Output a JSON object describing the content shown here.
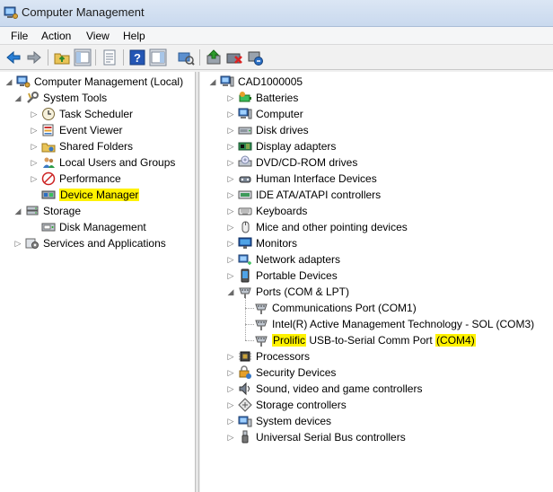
{
  "window": {
    "title": "Computer Management",
    "icon": "computer-management-icon"
  },
  "menu": [
    "File",
    "Action",
    "View",
    "Help"
  ],
  "toolbar": [
    "back-arrow-icon",
    "forward-arrow-icon",
    "up-folder-icon",
    "show-hide-console-tree-icon",
    "properties-icon",
    "help-icon",
    "action-pane-icon",
    "device-scan-icon",
    "update-driver-icon",
    "disable-device-icon",
    "uninstall-device-icon"
  ],
  "left_tree": [
    {
      "label": "Computer Management (Local)",
      "icon": "computer-management-icon",
      "expander": "expanded"
    },
    {
      "label": "System Tools",
      "icon": "system-tools-icon",
      "expander": "expanded"
    },
    {
      "label": "Task Scheduler",
      "icon": "task-scheduler-icon",
      "expander": "collapsed"
    },
    {
      "label": "Event Viewer",
      "icon": "event-viewer-icon",
      "expander": "collapsed"
    },
    {
      "label": "Shared Folders",
      "icon": "shared-folders-icon",
      "expander": "collapsed"
    },
    {
      "label": "Local Users and Groups",
      "icon": "users-icon",
      "expander": "collapsed"
    },
    {
      "label": "Performance",
      "icon": "performance-icon",
      "expander": "collapsed"
    },
    {
      "label": "Device Manager",
      "icon": "device-manager-icon",
      "expander": "none",
      "highlight": true
    },
    {
      "label": "Storage",
      "icon": "storage-icon",
      "expander": "expanded"
    },
    {
      "label": "Disk Management",
      "icon": "disk-management-icon",
      "expander": "none"
    },
    {
      "label": "Services and Applications",
      "icon": "services-icon",
      "expander": "collapsed"
    }
  ],
  "right_tree": {
    "root": {
      "label": "CAD1000005",
      "icon": "computer-icon"
    },
    "items": [
      {
        "label": "Batteries",
        "icon": "battery-icon"
      },
      {
        "label": "Computer",
        "icon": "computer-icon"
      },
      {
        "label": "Disk drives",
        "icon": "disk-drive-icon"
      },
      {
        "label": "Display adapters",
        "icon": "display-adapter-icon"
      },
      {
        "label": "DVD/CD-ROM drives",
        "icon": "dvd-drive-icon"
      },
      {
        "label": "Human Interface Devices",
        "icon": "hid-icon"
      },
      {
        "label": "IDE ATA/ATAPI controllers",
        "icon": "ide-controller-icon"
      },
      {
        "label": "Keyboards",
        "icon": "keyboard-icon"
      },
      {
        "label": "Mice and other pointing devices",
        "icon": "mouse-icon"
      },
      {
        "label": "Monitors",
        "icon": "monitor-icon"
      },
      {
        "label": "Network adapters",
        "icon": "network-adapter-icon"
      },
      {
        "label": "Portable Devices",
        "icon": "portable-device-icon"
      },
      {
        "label": "Ports (COM & LPT)",
        "icon": "port-icon",
        "expanded": true,
        "children": [
          {
            "label": "Communications Port (COM1)",
            "icon": "port-icon"
          },
          {
            "label": "Intel(R) Active Management Technology - SOL (COM3)",
            "icon": "port-icon"
          },
          {
            "label_parts": [
              {
                "text": "Prolific",
                "highlight": true
              },
              {
                "text": " USB-to-Serial Comm Port ",
                "highlight": false
              },
              {
                "text": "(COM4)",
                "highlight": true
              }
            ],
            "icon": "port-icon"
          }
        ]
      },
      {
        "label": "Processors",
        "icon": "processor-icon"
      },
      {
        "label": "Security Devices",
        "icon": "security-device-icon"
      },
      {
        "label": "Sound, video and game controllers",
        "icon": "sound-icon"
      },
      {
        "label": "Storage controllers",
        "icon": "storage-controller-icon"
      },
      {
        "label": "System devices",
        "icon": "system-device-icon"
      },
      {
        "label": "Universal Serial Bus controllers",
        "icon": "usb-icon"
      }
    ]
  },
  "colors": {
    "highlight": "#fff200",
    "titlebar": "#c9d9ee"
  }
}
